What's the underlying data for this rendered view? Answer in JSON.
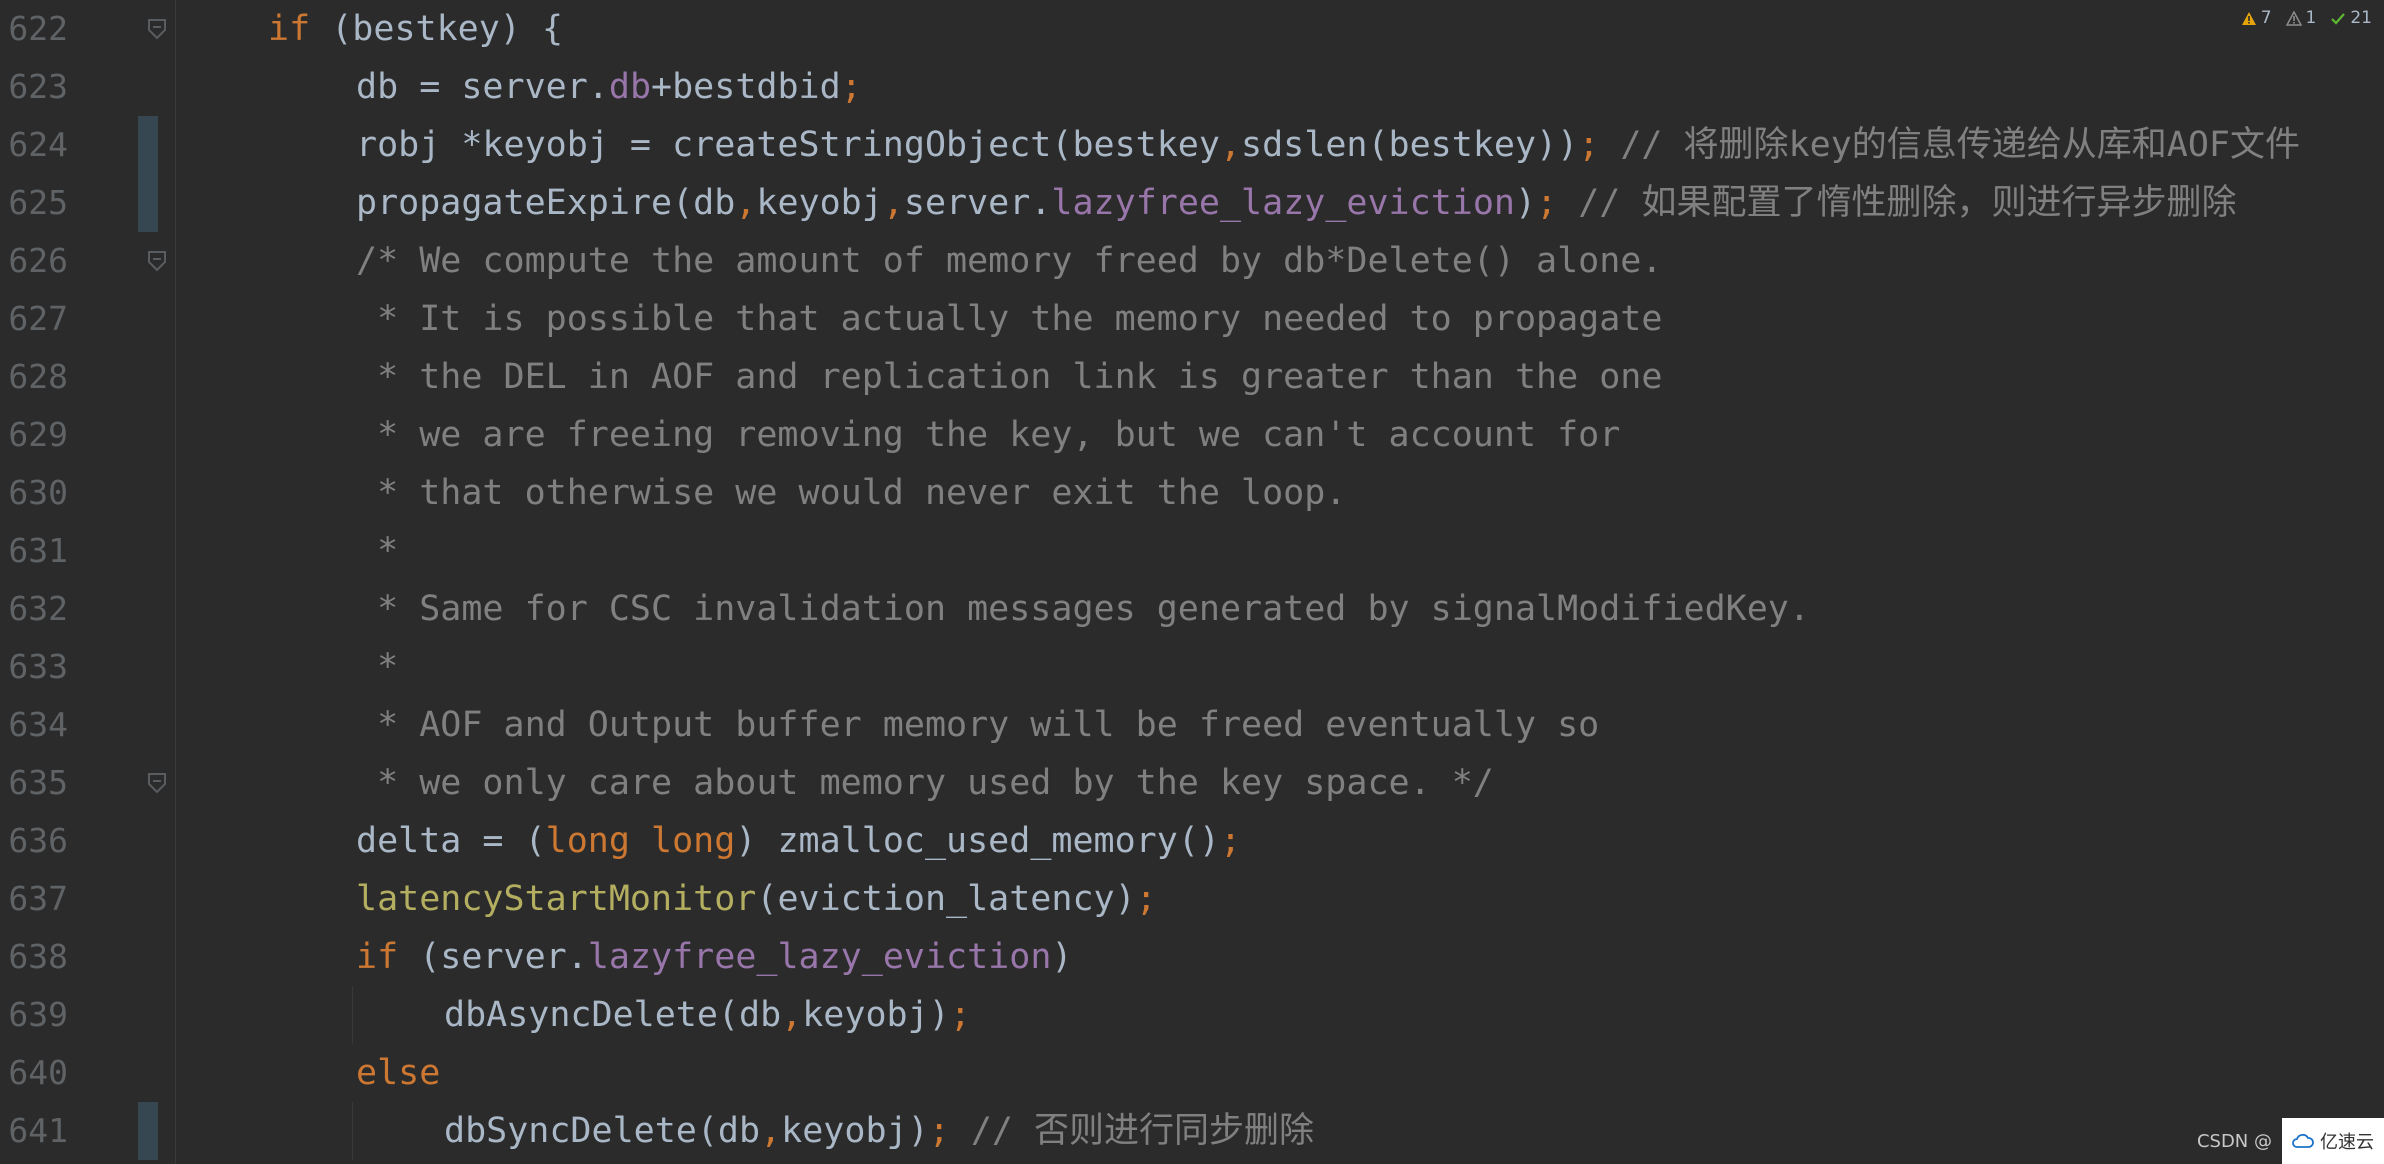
{
  "inspections": {
    "warnings": "7",
    "weak_warnings": "1",
    "ok": "21",
    "warning_color": "#e5a50a",
    "weak_color": "#8c8c8c",
    "ok_color": "#5fb832"
  },
  "lines": [
    {
      "num": "622",
      "indent": 1,
      "fold": true,
      "changed": false,
      "tokens": [
        [
          "kw",
          "if"
        ],
        [
          "op",
          " (bestkey) {"
        ]
      ]
    },
    {
      "num": "623",
      "indent": 2,
      "fold": false,
      "changed": false,
      "tokens": [
        [
          "op",
          "db = server."
        ],
        [
          "fld",
          "db"
        ],
        [
          "op",
          "+bestdbid"
        ],
        [
          "kw",
          ";"
        ]
      ]
    },
    {
      "num": "624",
      "indent": 2,
      "fold": false,
      "changed": true,
      "tokens": [
        [
          "op",
          "robj *keyobj = createStringObject(bestkey"
        ],
        [
          "kw",
          ","
        ],
        [
          "op",
          "sdslen(bestkey))"
        ],
        [
          "kw",
          ";"
        ],
        [
          "cmt",
          " // 将删除key的信息传递给从库和AOF文件"
        ]
      ]
    },
    {
      "num": "625",
      "indent": 2,
      "fold": false,
      "changed": true,
      "tokens": [
        [
          "op",
          "propagateExpire(db"
        ],
        [
          "kw",
          ","
        ],
        [
          "op",
          "keyobj"
        ],
        [
          "kw",
          ","
        ],
        [
          "op",
          "server."
        ],
        [
          "fld",
          "lazyfree_lazy_eviction"
        ],
        [
          "op",
          ")"
        ],
        [
          "kw",
          ";"
        ],
        [
          "cmt",
          " // 如果配置了惰性删除，则进行异步删除"
        ]
      ]
    },
    {
      "num": "626",
      "indent": 2,
      "fold": true,
      "changed": false,
      "tokens": [
        [
          "cmt",
          "/* We compute the amount of memory freed by db*Delete() alone."
        ]
      ]
    },
    {
      "num": "627",
      "indent": 2,
      "fold": false,
      "changed": false,
      "tokens": [
        [
          "cmt",
          " * It is possible that actually the memory needed to propagate"
        ]
      ]
    },
    {
      "num": "628",
      "indent": 2,
      "fold": false,
      "changed": false,
      "tokens": [
        [
          "cmt",
          " * the DEL in AOF and replication link is greater than the one"
        ]
      ]
    },
    {
      "num": "629",
      "indent": 2,
      "fold": false,
      "changed": false,
      "tokens": [
        [
          "cmt",
          " * we are freeing removing the key, but we can't account for"
        ]
      ]
    },
    {
      "num": "630",
      "indent": 2,
      "fold": false,
      "changed": false,
      "tokens": [
        [
          "cmt",
          " * that otherwise we would never exit the loop."
        ]
      ]
    },
    {
      "num": "631",
      "indent": 2,
      "fold": false,
      "changed": false,
      "tokens": [
        [
          "cmt",
          " *"
        ]
      ]
    },
    {
      "num": "632",
      "indent": 2,
      "fold": false,
      "changed": false,
      "tokens": [
        [
          "cmt",
          " * Same for CSC invalidation messages generated by signalModifiedKey."
        ]
      ]
    },
    {
      "num": "633",
      "indent": 2,
      "fold": false,
      "changed": false,
      "tokens": [
        [
          "cmt",
          " *"
        ]
      ]
    },
    {
      "num": "634",
      "indent": 2,
      "fold": false,
      "changed": false,
      "tokens": [
        [
          "cmt",
          " * AOF and Output buffer memory will be freed eventually so"
        ]
      ]
    },
    {
      "num": "635",
      "indent": 2,
      "fold": true,
      "changed": false,
      "tokens": [
        [
          "cmt",
          " * we only care about memory used by the key space. */"
        ]
      ]
    },
    {
      "num": "636",
      "indent": 2,
      "fold": false,
      "changed": false,
      "tokens": [
        [
          "op",
          "delta = ("
        ],
        [
          "kw",
          "long long"
        ],
        [
          "op",
          ") zmalloc_used_memory()"
        ],
        [
          "kw",
          ";"
        ]
      ]
    },
    {
      "num": "637",
      "indent": 2,
      "fold": false,
      "changed": false,
      "tokens": [
        [
          "fn",
          "latencyStartMonitor"
        ],
        [
          "op",
          "(eviction_latency)"
        ],
        [
          "kw",
          ";"
        ]
      ]
    },
    {
      "num": "638",
      "indent": 2,
      "fold": false,
      "changed": false,
      "tokens": [
        [
          "kw",
          "if"
        ],
        [
          "op",
          " (server."
        ],
        [
          "fld",
          "lazyfree_lazy_eviction"
        ],
        [
          "op",
          ")"
        ]
      ]
    },
    {
      "num": "639",
      "indent": 3,
      "fold": false,
      "changed": false,
      "tokens": [
        [
          "op",
          "dbAsyncDelete(db"
        ],
        [
          "kw",
          ","
        ],
        [
          "op",
          "keyobj)"
        ],
        [
          "kw",
          ";"
        ]
      ]
    },
    {
      "num": "640",
      "indent": 2,
      "fold": false,
      "changed": false,
      "tokens": [
        [
          "kw",
          "else"
        ]
      ]
    },
    {
      "num": "641",
      "indent": 3,
      "fold": false,
      "changed": true,
      "tokens": [
        [
          "op",
          "dbSyncDelete(db"
        ],
        [
          "kw",
          ","
        ],
        [
          "op",
          "keyobj)"
        ],
        [
          "kw",
          ";"
        ],
        [
          "cmt",
          " // 否则进行同步删除"
        ]
      ]
    }
  ],
  "watermark": {
    "csdn": "CSDN @",
    "brand": "亿速云"
  }
}
